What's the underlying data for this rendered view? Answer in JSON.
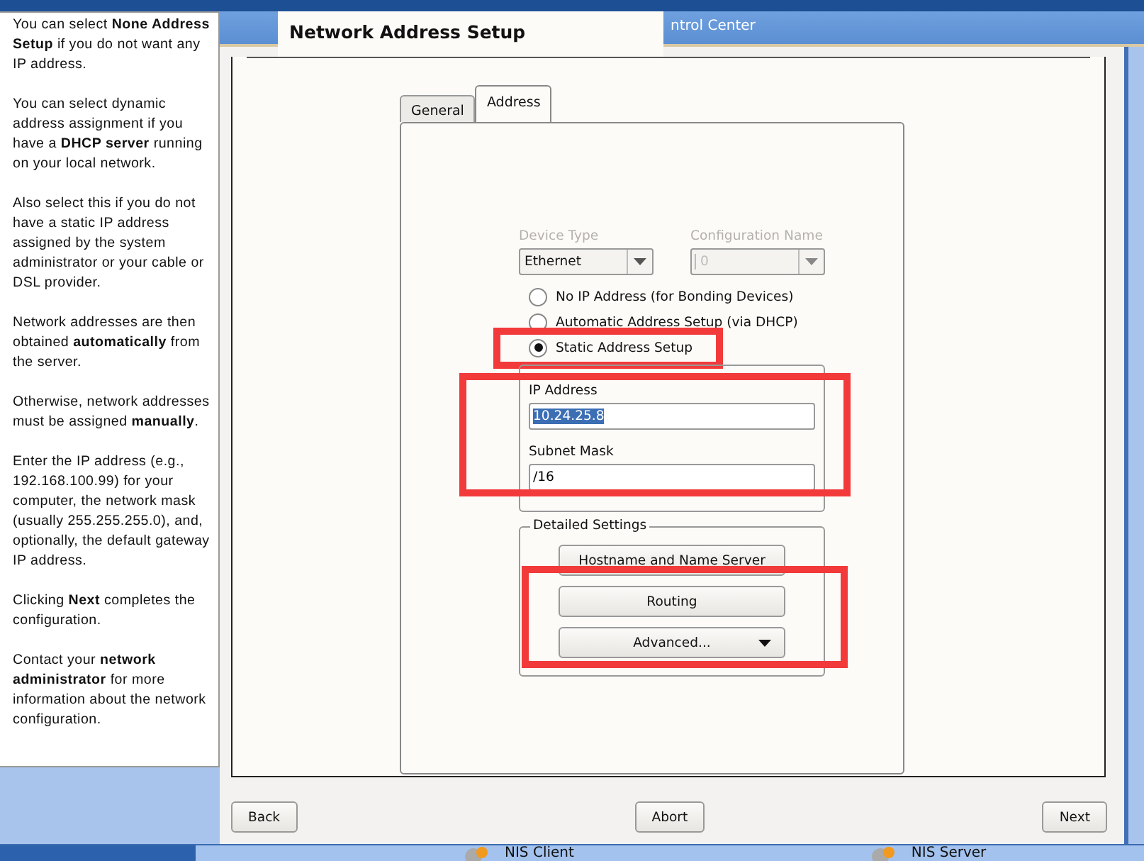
{
  "background_window": {
    "title": "ntrol Center"
  },
  "help_panel": {
    "paragraphs": [
      "You can select **None Address Setup** if you do not want any IP address.",
      "You can select dynamic address assignment if you have a **DHCP server** running on your local network.",
      "Also select this if you do not have a static IP address assigned by the system administrator or your cable or DSL provider.",
      "Network addresses are then obtained **automatically** from the server.",
      "Otherwise, network addresses must be assigned **manually**.",
      "Enter the IP address (e.g., 192.168.100.99) for your computer, the network mask (usually 255.255.255.0), and, optionally, the default gateway IP address.",
      "Clicking **Next** completes the configuration.",
      "Contact your **network administrator** for more information about the network configuration."
    ]
  },
  "dialog": {
    "title": "Network Address Setup",
    "tabs": [
      {
        "label": "General",
        "selected": false
      },
      {
        "label": "Address",
        "selected": true
      }
    ],
    "combos": [
      {
        "label": "Device Type",
        "value": "Ethernet",
        "disabled": false
      },
      {
        "label": "Configuration Name",
        "value": "0",
        "disabled": true
      }
    ],
    "radios": [
      {
        "label": "No IP Address (for Bonding Devices)",
        "selected": false,
        "highlighted": false
      },
      {
        "label": "Automatic Address Setup (via DHCP)",
        "selected": false,
        "highlighted": false
      },
      {
        "label": "Static Address Setup",
        "selected": true,
        "highlighted": true
      }
    ],
    "static_settings": {
      "highlighted": true,
      "fields": [
        {
          "label": "IP Address",
          "value": "10.24.25.8",
          "selected": true
        },
        {
          "label": "Subnet Mask",
          "value": "/16",
          "selected": false
        }
      ]
    },
    "detailed_settings": {
      "title": "Detailed Settings",
      "button_groups": [
        {
          "highlighted": false,
          "buttons": [
            {
              "label": "Hostname and Name Server",
              "kind": "plain"
            }
          ]
        },
        {
          "highlighted": true,
          "buttons": [
            {
              "label": "Routing",
              "kind": "plain"
            },
            {
              "label": "Advanced...",
              "kind": "menu"
            }
          ]
        }
      ]
    },
    "buttons": [
      "Back",
      "Abort",
      "Next"
    ]
  },
  "taskbar": {
    "items": [
      "NIS Client",
      "NIS Server"
    ]
  }
}
